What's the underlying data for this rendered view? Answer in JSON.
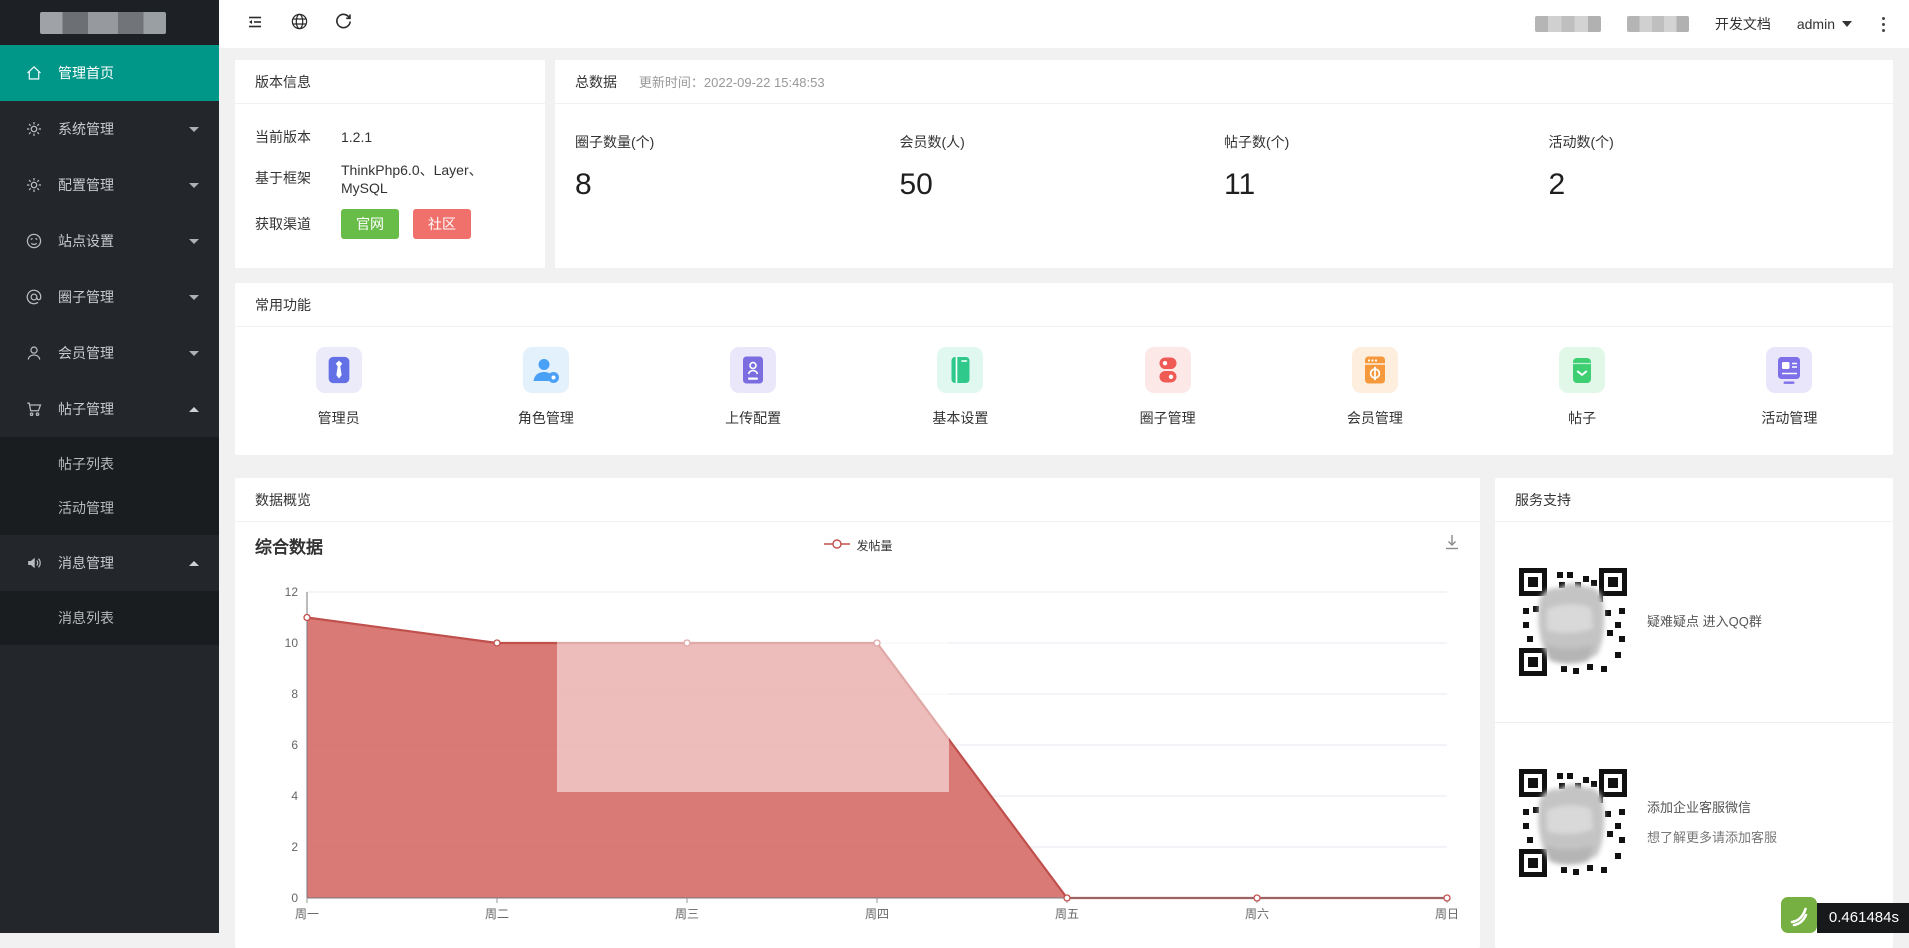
{
  "topbar": {
    "doc_link": "开发文档",
    "user": "admin"
  },
  "sidebar": {
    "items": [
      {
        "label": "管理首页",
        "icon": "home-icon",
        "active": true,
        "expandable": false
      },
      {
        "label": "系统管理",
        "icon": "gear-icon",
        "expandable": true,
        "expanded": false
      },
      {
        "label": "配置管理",
        "icon": "gear-icon",
        "expandable": true,
        "expanded": false
      },
      {
        "label": "站点设置",
        "icon": "face-icon",
        "expandable": true,
        "expanded": false
      },
      {
        "label": "圈子管理",
        "icon": "at-icon",
        "expandable": true,
        "expanded": false
      },
      {
        "label": "会员管理",
        "icon": "user-icon",
        "expandable": true,
        "expanded": false
      },
      {
        "label": "帖子管理",
        "icon": "cart-icon",
        "expandable": true,
        "expanded": true,
        "children": [
          "帖子列表",
          "活动管理"
        ]
      },
      {
        "label": "消息管理",
        "icon": "speaker-icon",
        "expandable": true,
        "expanded": true,
        "children": [
          "消息列表"
        ]
      }
    ]
  },
  "version_panel": {
    "title": "版本信息",
    "rows": [
      {
        "label": "当前版本",
        "value": "1.2.1"
      },
      {
        "label": "基于框架",
        "value": "ThinkPhp6.0、Layer、MySQL"
      }
    ],
    "channel_label": "获取渠道",
    "buttons": [
      {
        "label": "官网",
        "color": "#67bd48"
      },
      {
        "label": "社区",
        "color": "#f0716b"
      }
    ]
  },
  "stats_panel": {
    "title": "总数据",
    "update_label": "更新时间：2022-09-22 15:48:53",
    "items": [
      {
        "label": "圈子数量(个)",
        "value": "8"
      },
      {
        "label": "会员数(人)",
        "value": "50"
      },
      {
        "label": "帖子数(个)",
        "value": "11"
      },
      {
        "label": "活动数(个)",
        "value": "2"
      }
    ]
  },
  "functions_panel": {
    "title": "常用功能",
    "items": [
      {
        "label": "管理员",
        "icon": "admin-icon",
        "bg": "#ebebfa",
        "color": "#6470e6"
      },
      {
        "label": "角色管理",
        "icon": "role-icon",
        "bg": "#e3f1fc",
        "color": "#4aa0f5"
      },
      {
        "label": "上传配置",
        "icon": "upload-config-icon",
        "bg": "#eae7fa",
        "color": "#7b6ce0"
      },
      {
        "label": "基本设置",
        "icon": "basic-settings-icon",
        "bg": "#e0f8ef",
        "color": "#2fc98c"
      },
      {
        "label": "圈子管理",
        "icon": "circle-manage-icon",
        "bg": "#fde8e8",
        "color": "#f05a55"
      },
      {
        "label": "会员管理",
        "icon": "member-manage-icon",
        "bg": "#fdeede",
        "color": "#f6993c"
      },
      {
        "label": "帖子",
        "icon": "post-icon",
        "bg": "#e1f8e8",
        "color": "#3ecf72"
      },
      {
        "label": "活动管理",
        "icon": "activity-manage-icon",
        "bg": "#e9e6fb",
        "color": "#7d70e8"
      }
    ]
  },
  "overview_panel": {
    "title": "数据概览"
  },
  "chart_data": {
    "type": "area",
    "title": "综合数据",
    "categories": [
      "周一",
      "周二",
      "周三",
      "周四",
      "周五",
      "周六",
      "周日"
    ],
    "series": [
      {
        "name": "发帖量",
        "values": [
          11,
          10,
          10,
          10,
          0,
          0,
          0
        ],
        "color": "#c0504c",
        "fill": "#d56863"
      }
    ],
    "ylim": [
      0,
      12
    ],
    "ytick_step": 2,
    "grid": true,
    "legend_position": "top-center"
  },
  "support_panel": {
    "title": "服务支持",
    "qr_items": [
      {
        "lines": [
          "疑难疑点 进入QQ群"
        ]
      },
      {
        "lines": [
          "添加企业客服微信",
          "想了解更多请添加客服"
        ]
      }
    ]
  },
  "trace": {
    "time": "0.461484s"
  }
}
